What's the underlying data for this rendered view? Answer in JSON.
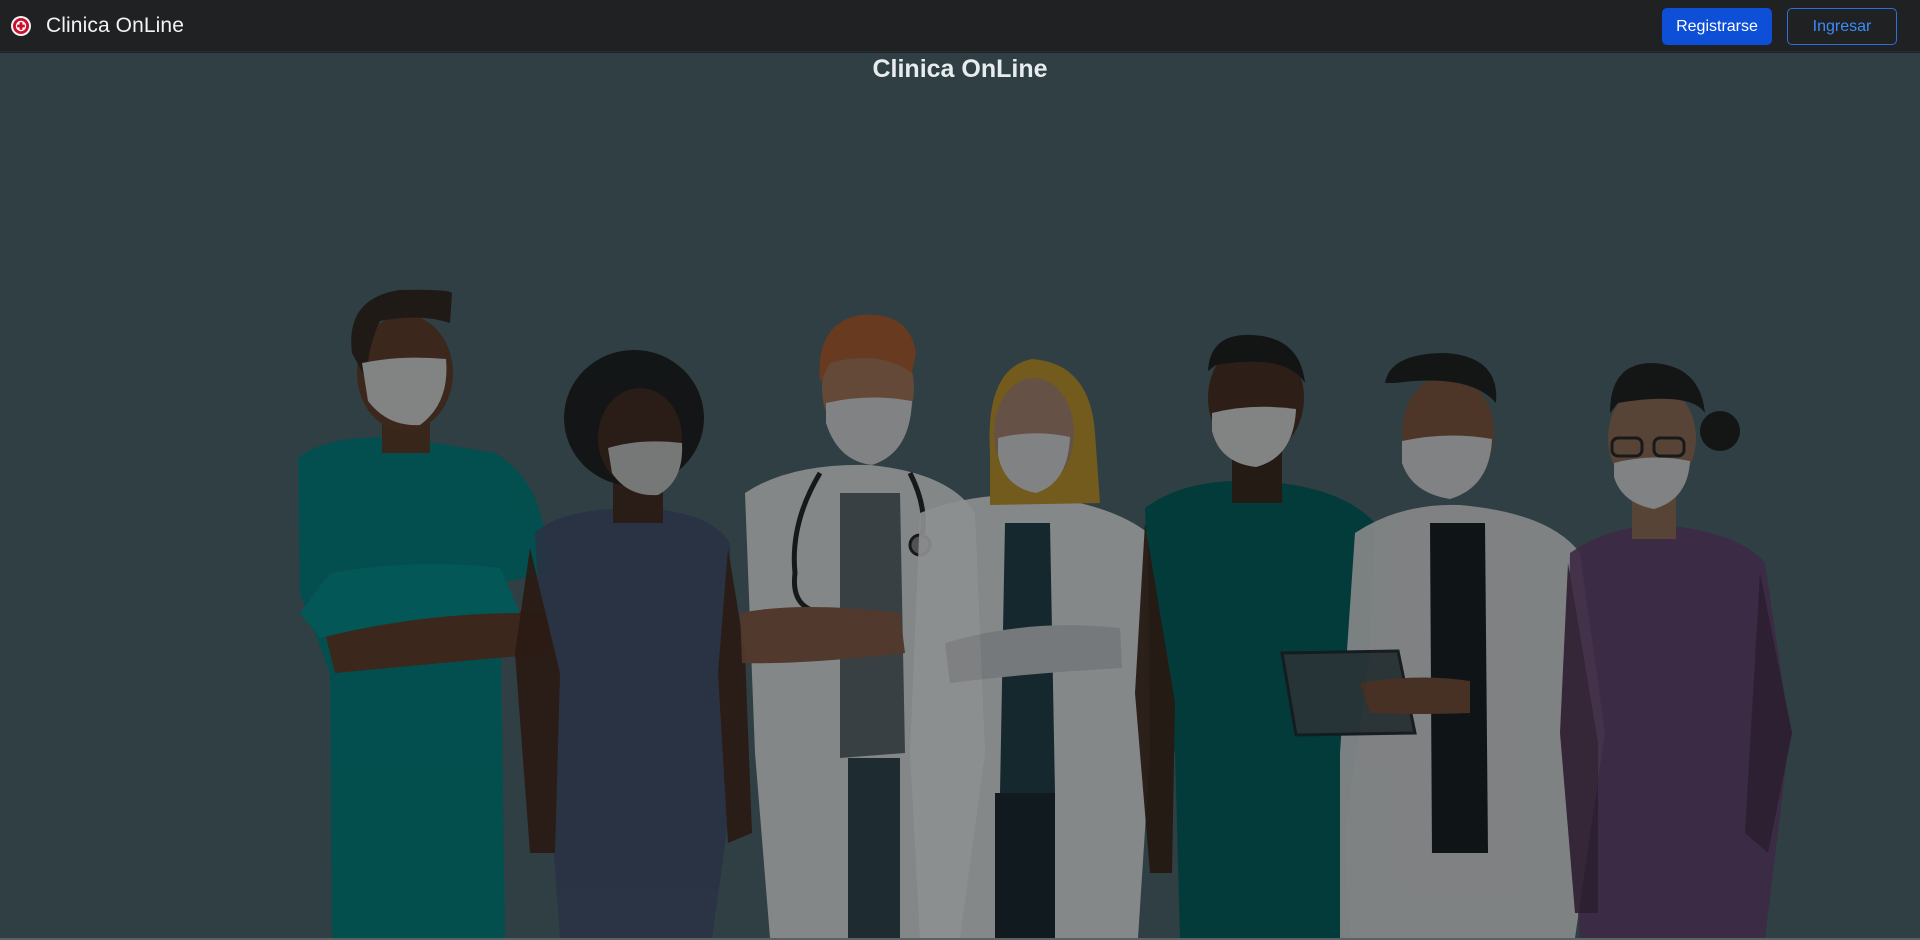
{
  "navbar": {
    "brand_title": "Clinica OnLine",
    "logo_icon": "clinic-logo-icon",
    "register_label": "Registrarse",
    "login_label": "Ingresar"
  },
  "hero": {
    "title": "Clinica OnLine",
    "illustration": "medical-team-illustration"
  },
  "colors": {
    "navbar_bg": "#1f2123",
    "hero_bg": "#2f3f44",
    "primary_button": "#0d4fd6",
    "outline_button": "#3d8bfd"
  }
}
